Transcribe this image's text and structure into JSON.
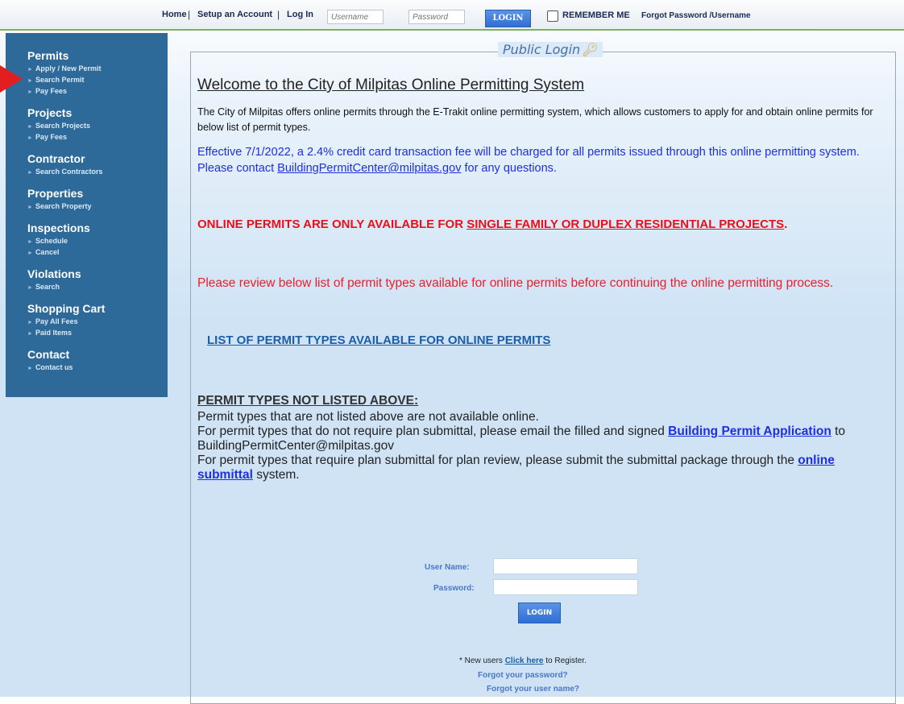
{
  "topbar": {
    "home": "Home",
    "setup_account": "Setup an Account",
    "log_in": "Log In",
    "username_placeholder": "Username",
    "password_placeholder": "Password",
    "login_button": "LOGIN",
    "remember_me": "REMEMBER ME",
    "forgot": "Forgot Password /Username",
    "separator": "|"
  },
  "sidebar": {
    "permits": {
      "title": "Permits",
      "items": [
        "Apply / New Permit",
        "Search Permit",
        "Pay Fees"
      ]
    },
    "projects": {
      "title": "Projects",
      "items": [
        "Search Projects",
        "Pay Fees"
      ]
    },
    "contractor": {
      "title": "Contractor",
      "items": [
        "Search Contractors"
      ]
    },
    "properties": {
      "title": "Properties",
      "items": [
        "Search Property"
      ]
    },
    "inspections": {
      "title": "Inspections",
      "items": [
        "Schedule",
        "Cancel"
      ]
    },
    "violations": {
      "title": "Violations",
      "items": [
        "Search"
      ]
    },
    "shopping_cart": {
      "title": "Shopping Cart",
      "items": [
        "Pay All Fees",
        "Paid Items"
      ]
    },
    "contact": {
      "title": "Contact",
      "items": [
        "Contact us"
      ]
    },
    "arrow": "►"
  },
  "main": {
    "legend": "Public Login",
    "welcome": "Welcome to the City of Milpitas Online Permitting System",
    "intro": "The City of Milpitas offers online permits through the E-Trakit online permitting system, which allows customers to apply for and obtain online permits for below list of permit types.",
    "fee_pre": "Effective 7/1/2022, a 2.4% credit card transaction fee will be charged for all permits issued through this online permitting system.  Please contact ",
    "fee_email": "BuildingPermitCenter@milpitas.gov",
    "fee_post": " for any questions.",
    "warn_pre": "ONLINE PERMITS ARE ONLY AVAILABLE FOR ",
    "warn_link": "SINGLE FAMILY OR DUPLEX RESIDENTIAL PROJECTS",
    "warn_post": ".",
    "review": "Please review below list of permit types available for online permits before continuing the online permitting process.",
    "list_link": "LIST OF PERMIT TYPES AVAILABLE FOR ONLINE PERMITS",
    "not_listed_heading": "PERMIT TYPES NOT LISTED ABOVE:",
    "not_listed_1": "Permit types that are not listed above are not available online.",
    "not_listed_2_pre": "For permit types that do not require plan submittal, please email the filled and signed ",
    "not_listed_2_link": "Building Permit Application",
    "not_listed_2_post": " to BuildingPermitCenter@milpitas.gov",
    "not_listed_3_pre": "For permit types that require plan submittal for plan review, please submit the submittal package through the ",
    "not_listed_3_link": "online submittal",
    "not_listed_3_post": " system."
  },
  "login_form": {
    "username_label": "User Name:",
    "password_label": "Password:",
    "login_button": "LOGIN",
    "new_users_pre": "* New users ",
    "click_here": "Click here",
    "new_users_post": "  to Register.",
    "forgot_password": "Forgot your password?",
    "forgot_username": "Forgot your user name?"
  }
}
